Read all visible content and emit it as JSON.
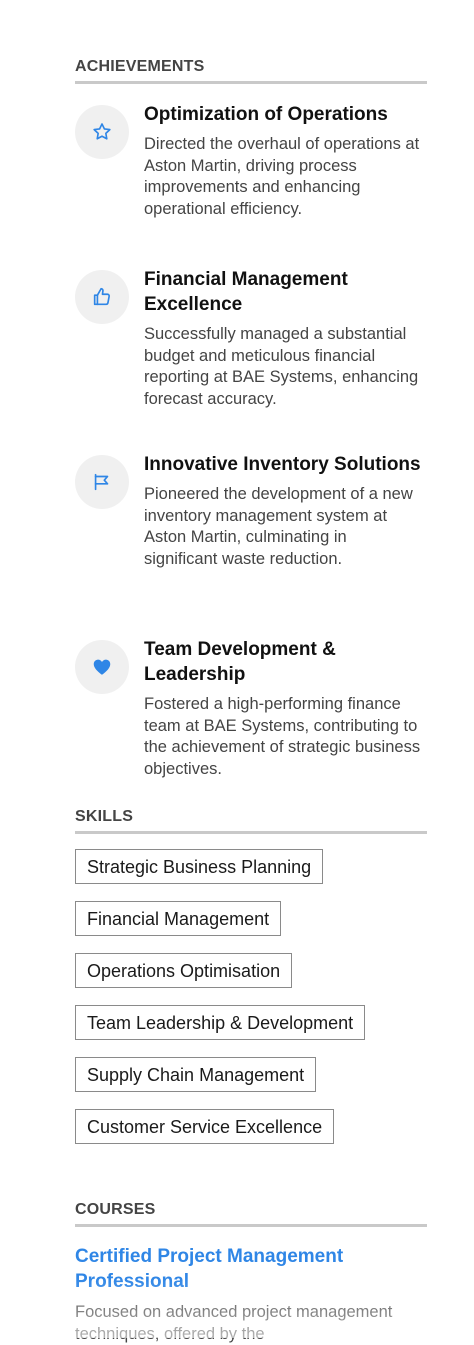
{
  "achievements": {
    "heading": "ACHIEVEMENTS",
    "items": [
      {
        "icon": "star-icon",
        "title": "Optimization of Operations",
        "description": "Directed the overhaul of operations at Aston Martin, driving process improvements and enhancing operational efficiency."
      },
      {
        "icon": "thumbs-up-icon",
        "title": "Financial Management Excellence",
        "description": "Successfully managed a substantial budget and meticulous financial reporting at BAE Systems, enhancing forecast accuracy."
      },
      {
        "icon": "flag-icon",
        "title": "Innovative Inventory Solutions",
        "description": "Pioneered the development of a new inventory management system at Aston Martin, culminating in significant waste reduction."
      },
      {
        "icon": "heart-icon",
        "title": "Team Development & Leadership",
        "description": "Fostered a high-performing finance team at BAE Systems, contributing to the achievement of strategic business objectives."
      }
    ]
  },
  "skills": {
    "heading": "SKILLS",
    "items": [
      "Strategic Business Planning",
      "Financial Management",
      "Operations Optimisation",
      "Team Leadership & Development",
      "Supply Chain Management",
      "Customer Service Excellence"
    ]
  },
  "courses": {
    "heading": "COURSES",
    "items": [
      {
        "title": "Certified Project Management Professional",
        "description": "Focused on advanced project management techniques, offered by the"
      }
    ]
  },
  "colors": {
    "accent": "#2f86e6",
    "icon_bg": "#f0f0f0",
    "rule": "#c9c9c9"
  }
}
